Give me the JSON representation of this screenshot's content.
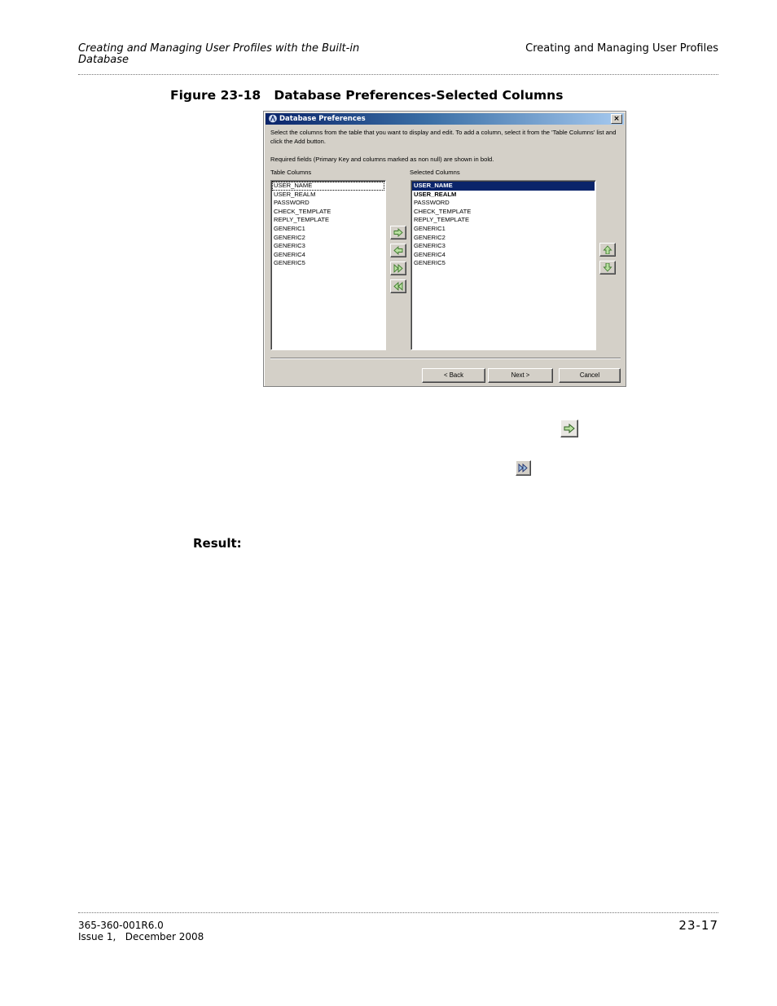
{
  "header": {
    "left": "Creating and Managing User Profiles with the Built-in Database",
    "right": "Creating and Managing User Profiles"
  },
  "figure": {
    "caption": "Figure 23-18   Database Preferences-Selected Columns"
  },
  "dialog": {
    "title": "Database Preferences",
    "close_glyph": "×",
    "instructions": "Select the columns from the table that you want to display and edit. To add a column, select it from the 'Table Columns' list and click the Add button.",
    "required_note": "Required fields (Primary Key and columns marked as non null) are shown in bold.",
    "table_columns_label": "Table Columns",
    "selected_columns_label": "Selected Columns",
    "table_columns": [
      "USER_NAME",
      "USER_REALM",
      "PASSWORD",
      "CHECK_TEMPLATE",
      "REPLY_TEMPLATE",
      "GENERIC1",
      "GENERIC2",
      "GENERIC3",
      "GENERIC4",
      "GENERIC5"
    ],
    "selected_columns": [
      "USER_NAME",
      "USER_REALM",
      "PASSWORD",
      "CHECK_TEMPLATE",
      "REPLY_TEMPLATE",
      "GENERIC1",
      "GENERIC2",
      "GENERIC3",
      "GENERIC4",
      "GENERIC5"
    ],
    "buttons": {
      "back": "< Back",
      "next": "Next >",
      "cancel": "Cancel"
    },
    "icons": {
      "add": "arrow-right-icon",
      "remove": "arrow-left-icon",
      "add_all": "double-arrow-right-icon",
      "remove_all": "double-arrow-left-icon",
      "move_up": "arrow-up-icon",
      "move_down": "arrow-down-icon"
    },
    "colors": {
      "titlebar": "#0a246a",
      "selection": "#0a246a",
      "face": "#d4d0c8"
    }
  },
  "body": {
    "result_label": "Result:"
  },
  "footer": {
    "doc_number": "365-360-001R6.0",
    "issue": "Issue 1,   December 2008",
    "page": "23-17"
  }
}
